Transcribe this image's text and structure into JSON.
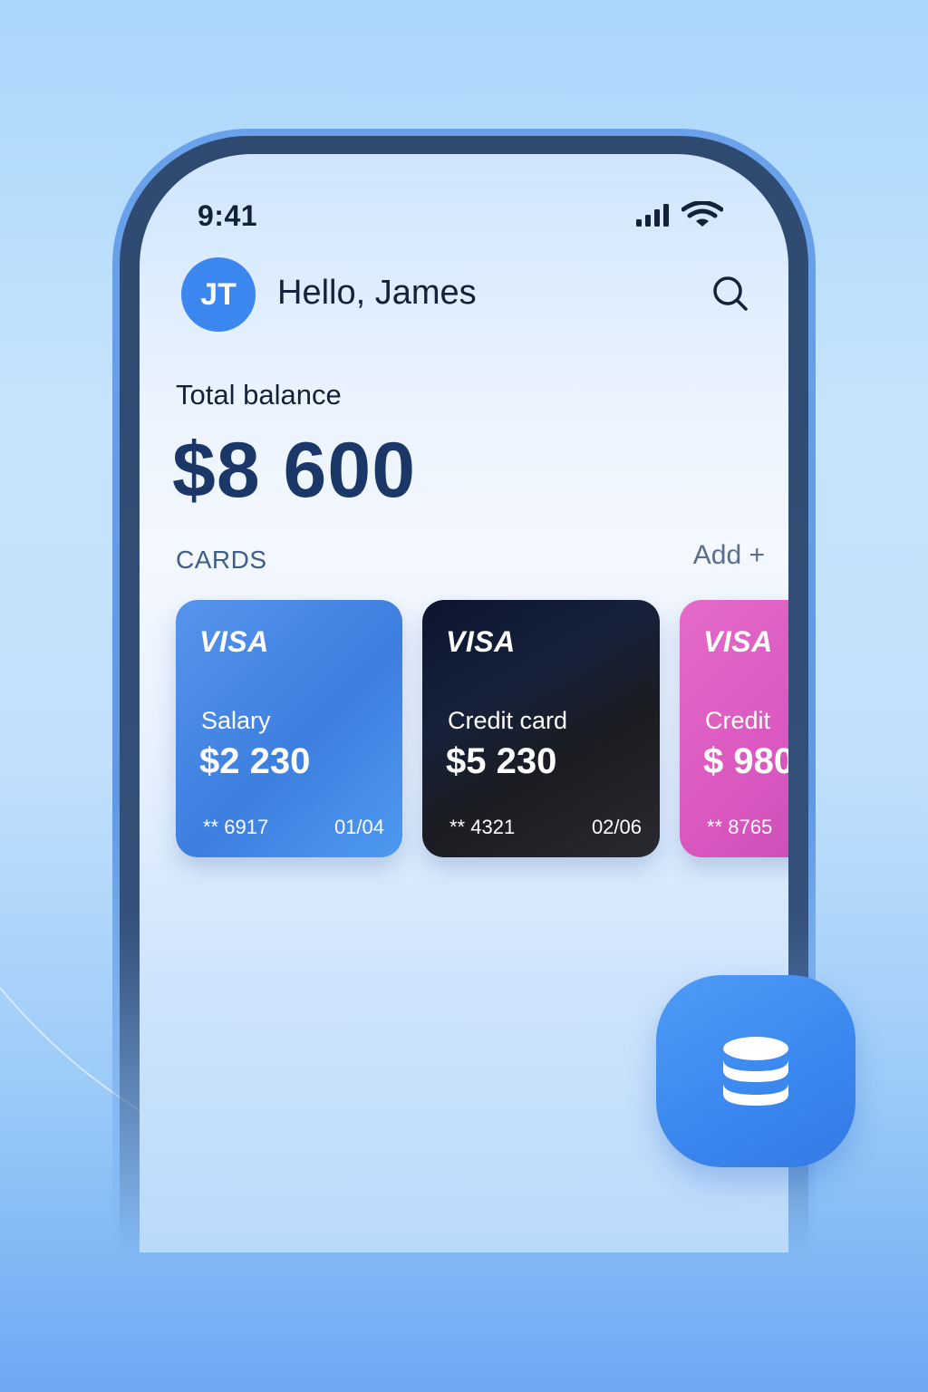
{
  "status_bar": {
    "time": "9:41"
  },
  "header": {
    "avatar_initials": "JT",
    "greeting": "Hello, James",
    "search_icon": "search-icon"
  },
  "balance": {
    "label": "Total balance",
    "value": "$8 600"
  },
  "cards_section": {
    "label": "CARDS",
    "add_label": "Add +",
    "cards": [
      {
        "brand": "VISA",
        "name": "Salary",
        "amount": "$2 230",
        "number": "** 6917",
        "expiry": "01/04",
        "color": "#4a8ae8"
      },
      {
        "brand": "VISA",
        "name": "Credit card",
        "amount": "$5 230",
        "number": "** 4321",
        "expiry": "02/06",
        "color": "#141a28"
      },
      {
        "brand": "VISA",
        "name": "Credit",
        "amount": "$ 980",
        "number": "** 8765",
        "expiry": "",
        "color": "#dc5ec3"
      }
    ]
  },
  "fab": {
    "icon": "database-icon",
    "color": "#3a87ef"
  }
}
